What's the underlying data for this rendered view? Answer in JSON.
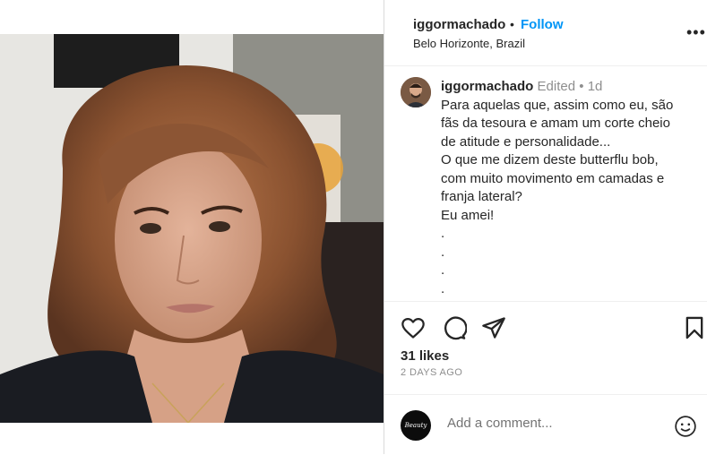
{
  "post": {
    "username": "iggormachado",
    "separator": "•",
    "follow_label": "Follow",
    "location": "Belo Horizonte, Brazil",
    "more_label": "•••"
  },
  "caption": {
    "username": "iggormachado",
    "edited_label": "Edited",
    "dot": "•",
    "age": "1d",
    "lines": [
      "Para aquelas que, assim como eu, são",
      "fãs da tesoura e amam um corte cheio",
      "de atitude e personalidade...",
      "O que me dizem deste butterflu bob,",
      "com muito movimento em camadas e",
      "franja lateral?",
      "Eu amei!",
      ".",
      ".",
      ".",
      "."
    ]
  },
  "stats": {
    "likes": "31 likes",
    "posted": "2 DAYS AGO"
  },
  "comment_box": {
    "placeholder": "Add a comment...",
    "avatar_text": "Beauty"
  },
  "icons": {
    "like": "heart-icon",
    "comment": "comment-icon",
    "share": "share-icon",
    "save": "bookmark-icon",
    "emoji": "emoji-icon",
    "more": "more-icon"
  },
  "colors": {
    "accent": "#0095f6",
    "text": "#262626",
    "muted": "#8e8e8e",
    "border": "#dbdbdb"
  }
}
